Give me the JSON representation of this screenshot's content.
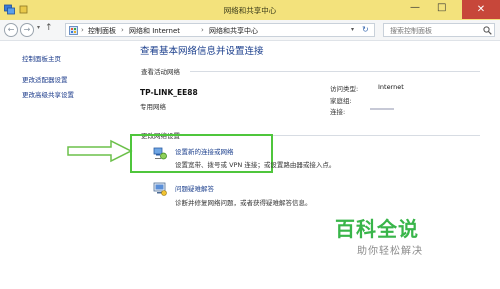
{
  "window": {
    "title": "网络和共享中心",
    "minimize": "—",
    "maximize": "□",
    "close": "✕"
  },
  "addressbar": {
    "back_icon": "arrow-left-icon",
    "forward_icon": "arrow-right-icon",
    "up_icon": "arrow-up-icon",
    "breadcrumbs": [
      "控制面板",
      "网络和 Internet",
      "网络和共享中心"
    ],
    "separator": "›",
    "search_placeholder": "搜索控制面板"
  },
  "sidebar": {
    "items": [
      {
        "label": "控制面板主页"
      },
      {
        "label": "更改适配器设置"
      },
      {
        "label": "更改高级共享设置"
      }
    ]
  },
  "main": {
    "title": "查看基本网络信息并设置连接",
    "active_networks_label": "查看活动网络",
    "network": {
      "name": "TP-LINK_EE88",
      "type": "专用网络",
      "access_type_label": "访问类型:",
      "access_type_value": "Internet",
      "homegroup_label": "家庭组:",
      "connection_label": "连接:"
    },
    "change_settings_label": "更改网络设置",
    "tasks": [
      {
        "link": "设置新的连接或网络",
        "desc": "设置宽带、拨号或 VPN 连接；或设置路由器或接入点。",
        "icon": "network-setup-icon"
      },
      {
        "link": "问题疑难解答",
        "desc": "诊断并修复网络问题，或者获得疑难解答信息。",
        "icon": "troubleshoot-icon"
      }
    ]
  },
  "watermark": {
    "main": "百科全说",
    "sub": "助你轻松解决"
  },
  "colors": {
    "titlebar": "#f3e27c",
    "link": "#1a3e8c",
    "highlight": "#4fc63c",
    "close": "#c7473a"
  }
}
